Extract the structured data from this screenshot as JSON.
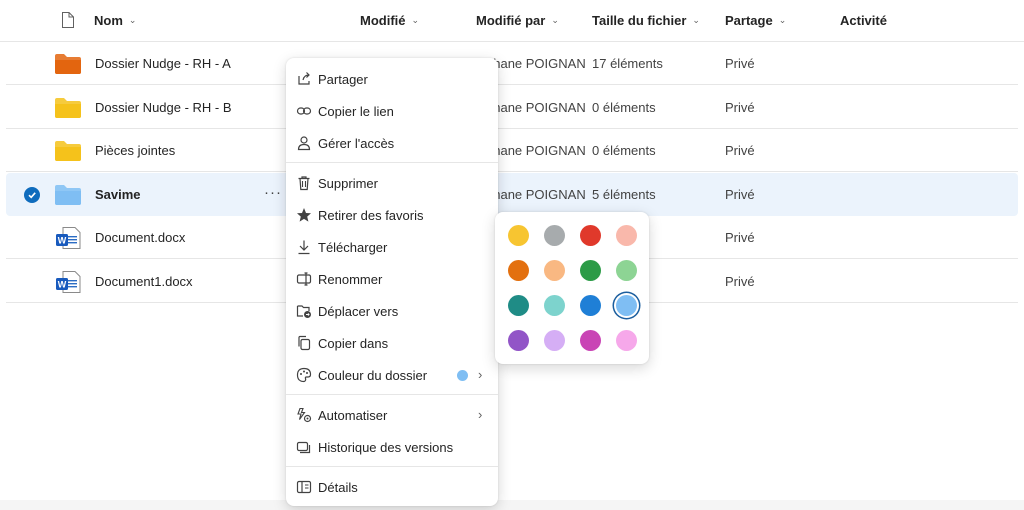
{
  "columns": {
    "name": "Nom",
    "modified": "Modifié",
    "modified_by": "Modifié par",
    "file_size": "Taille du fichier",
    "sharing": "Partage",
    "activity": "Activité"
  },
  "rows": [
    {
      "name": "Dossier Nudge - RH - A",
      "icon": "folder-icon",
      "folder_color": "#e3650f",
      "modified_by": "ohane POIGNANT",
      "size": "17 éléments",
      "sharing": "Privé"
    },
    {
      "name": "Dossier Nudge - RH - B",
      "icon": "folder-icon",
      "folder_color": "#f5c21b",
      "modified_by": "ohane POIGNANT",
      "size": "0 éléments",
      "sharing": "Privé"
    },
    {
      "name": "Pièces jointes",
      "icon": "folder-icon",
      "folder_color": "#f5c21b",
      "modified_by": "ohane POIGNANT",
      "size": "0 éléments",
      "sharing": "Privé"
    },
    {
      "name": "Savime",
      "icon": "folder-icon",
      "folder_color": "#7fbef3",
      "modified_by": "ohane POIGNANT",
      "size": "5 éléments",
      "sharing": "Privé",
      "selected": true
    },
    {
      "name": "Document.docx",
      "icon": "word-doc-icon",
      "modified_by": "",
      "size": "",
      "sharing": "Privé"
    },
    {
      "name": "Document1.docx",
      "icon": "word-doc-icon",
      "modified_by": "",
      "size": "",
      "sharing": "Privé"
    }
  ],
  "more_glyph": "···",
  "context_menu": {
    "items": [
      {
        "label": "Partager",
        "icon": "share-icon"
      },
      {
        "label": "Copier le lien",
        "icon": "link-icon"
      },
      {
        "label": "Gérer l'accès",
        "icon": "person-icon"
      },
      {
        "label": "Supprimer",
        "icon": "trash-icon"
      },
      {
        "label": "Retirer des favoris",
        "icon": "star-icon"
      },
      {
        "label": "Télécharger",
        "icon": "download-icon"
      },
      {
        "label": "Renommer",
        "icon": "rename-icon"
      },
      {
        "label": "Déplacer vers",
        "icon": "move-folder-icon"
      },
      {
        "label": "Copier dans",
        "icon": "copy-icon"
      },
      {
        "label": "Couleur du dossier",
        "icon": "palette-icon",
        "current_color": "#7fbef3"
      },
      {
        "label": "Automatiser",
        "icon": "automate-icon"
      },
      {
        "label": "Historique des versions",
        "icon": "history-icon"
      },
      {
        "label": "Détails",
        "icon": "details-icon"
      }
    ],
    "submenu_arrow": "›"
  },
  "folder_colors": [
    "#f7c531",
    "#a7abad",
    "#e0392b",
    "#f9b8ab",
    "#e3700f",
    "#f9b882",
    "#2c9b47",
    "#8dd494",
    "#1f8c86",
    "#7dd3cd",
    "#1f7fd6",
    "#7fbef3",
    "#9255c7",
    "#d5aef5",
    "#c944b5",
    "#f6a8ea"
  ],
  "selected_color": "#7fbef3"
}
